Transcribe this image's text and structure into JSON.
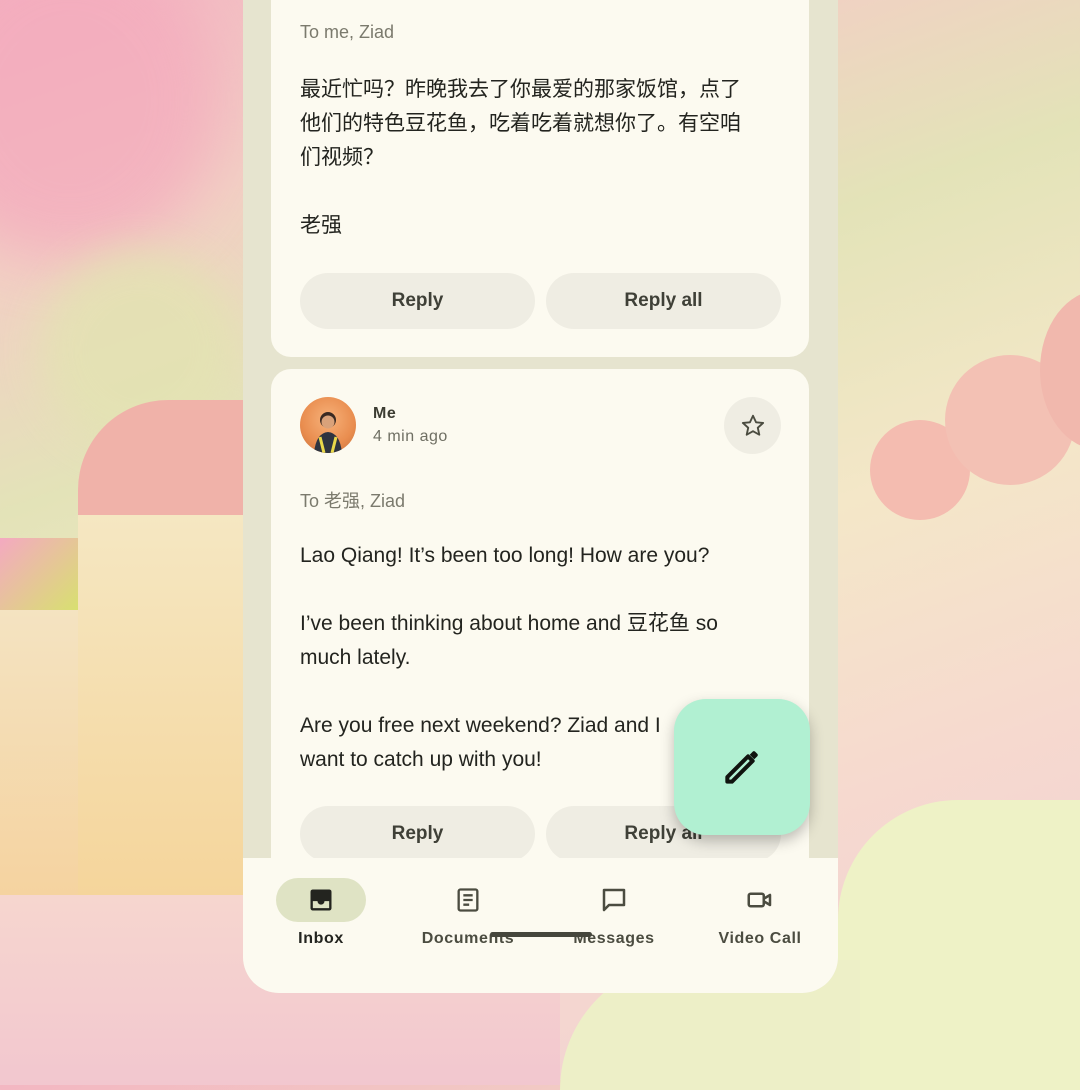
{
  "email_top": {
    "recipients": "To me, Ziad",
    "body": "最近忙吗？昨晚我去了你最爱的那家饭馆，点了\n他们的特色豆花鱼，吃着吃着就想你了。有空咱\n们视频？\n\n老强",
    "reply_label": "Reply",
    "reply_all_label": "Reply all"
  },
  "email_bottom": {
    "sender": "Me",
    "time": "4 min ago",
    "star_icon": "star-outline-icon",
    "recipients": "To 老强, Ziad",
    "body": "Lao Qiang! It’s been too long! How are you?\n\nI’ve been thinking about home and 豆花鱼 so\nmuch lately.\n\nAre you free next weekend? Ziad and I\nwant to catch up with you!",
    "reply_label": "Reply",
    "reply_all_label": "Reply all"
  },
  "fab": {
    "icon": "pencil-icon"
  },
  "nav": {
    "items": [
      {
        "label": "Inbox",
        "icon": "inbox-icon",
        "active": true
      },
      {
        "label": "Documents",
        "icon": "document-icon",
        "active": false
      },
      {
        "label": "Messages",
        "icon": "message-icon",
        "active": false
      },
      {
        "label": "Video Call",
        "icon": "video-call-icon",
        "active": false
      }
    ]
  },
  "colors": {
    "surface": "#fcfaf0",
    "pill": "#efede3",
    "fab": "#b1f0d2",
    "active_indicator": "#dfe3c4"
  }
}
